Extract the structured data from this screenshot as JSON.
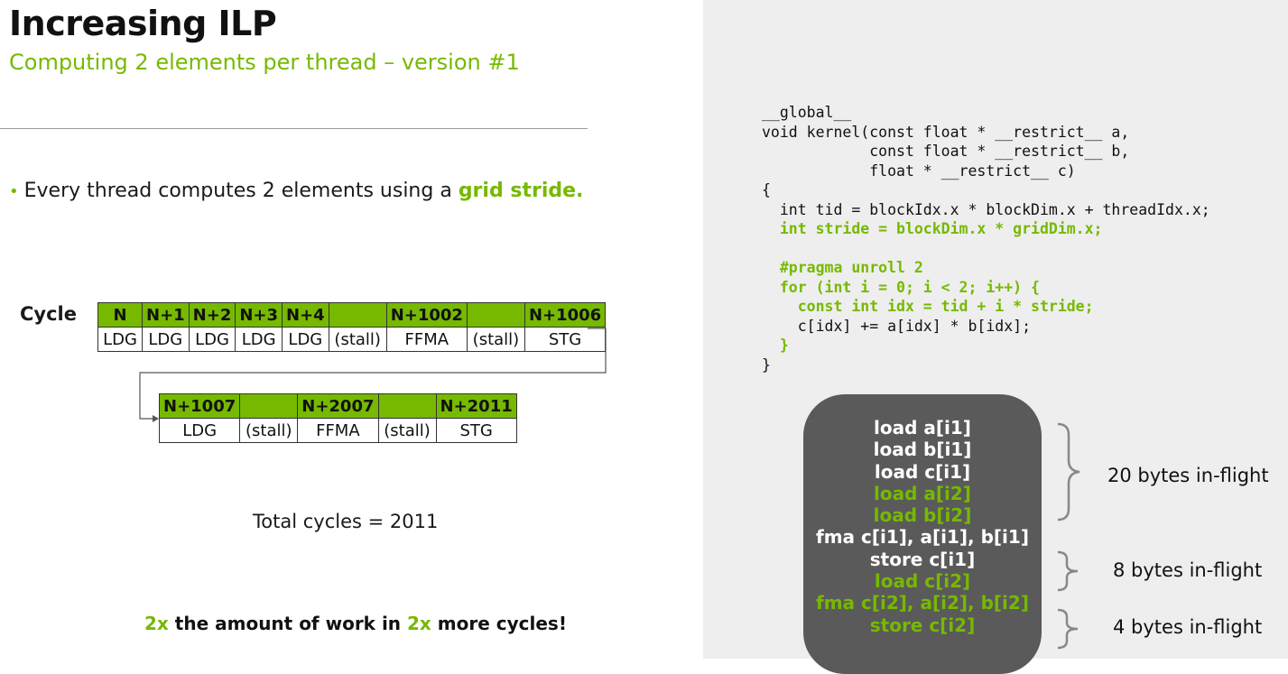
{
  "slide": {
    "title": "Increasing ILP",
    "subtitle": "Computing 2 elements per thread – version #1"
  },
  "bullet": {
    "marker": "•",
    "text": "Every thread computes 2 elements using a ",
    "highlight": "grid stride."
  },
  "pipeline": {
    "cycle_label": "Cycle",
    "row1": {
      "headers": [
        "N",
        "N+1",
        "N+2",
        "N+3",
        "N+4",
        "",
        "N+1002",
        "",
        "N+1006"
      ],
      "ops": [
        "LDG",
        "LDG",
        "LDG",
        "LDG",
        "LDG",
        "(stall)",
        "FFMA",
        "(stall)",
        "STG"
      ]
    },
    "row2": {
      "headers": [
        "N+1007",
        "",
        "N+2007",
        "",
        "N+2011"
      ],
      "ops": [
        "LDG",
        "(stall)",
        "FFMA",
        "(stall)",
        "STG"
      ]
    },
    "total": "Total cycles = 2011"
  },
  "conclusion": {
    "part1": "2x",
    "part2": " the amount of work in ",
    "part3": "2x",
    "part4": " more cycles!"
  },
  "code": {
    "l01": "__global__",
    "l02": "void kernel(const float * __restrict__ a,",
    "l03": "            const float * __restrict__ b,",
    "l04": "            float * __restrict__ c)",
    "l05": "{",
    "l06": "  int tid = blockIdx.x * blockDim.x + threadIdx.x;",
    "l07": "  int stride = blockDim.x * gridDim.x;",
    "l08": "",
    "l09": "  #pragma unroll 2",
    "l10": "  for (int i = 0; i < 2; i++) {",
    "l11": "    const int idx = tid + i * stride;",
    "l12": "    c[idx] += a[idx] * b[idx];",
    "l13": "  }",
    "l14": "}"
  },
  "instructions": [
    {
      "text": "load a[i1]",
      "highlight": false
    },
    {
      "text": "load b[i1]",
      "highlight": false
    },
    {
      "text": "load c[i1]",
      "highlight": false
    },
    {
      "text": "load a[i2]",
      "highlight": true
    },
    {
      "text": "load b[i2]",
      "highlight": true
    },
    {
      "text": "fma c[i1], a[i1], b[i1]",
      "highlight": false
    },
    {
      "text": "store c[i1]",
      "highlight": false
    },
    {
      "text": "load c[i2]",
      "highlight": true
    },
    {
      "text": "fma c[i2], a[i2], b[i2]",
      "highlight": true
    },
    {
      "text": "store c[i2]",
      "highlight": true
    }
  ],
  "in_flight": {
    "group1": "20 bytes in-flight",
    "group2": "8 bytes in-flight",
    "group3": "4 bytes in-flight"
  },
  "colors": {
    "accent": "#76b900",
    "stall": "#e00000",
    "box": "#5a5a5a",
    "panel": "#eeeeee"
  }
}
